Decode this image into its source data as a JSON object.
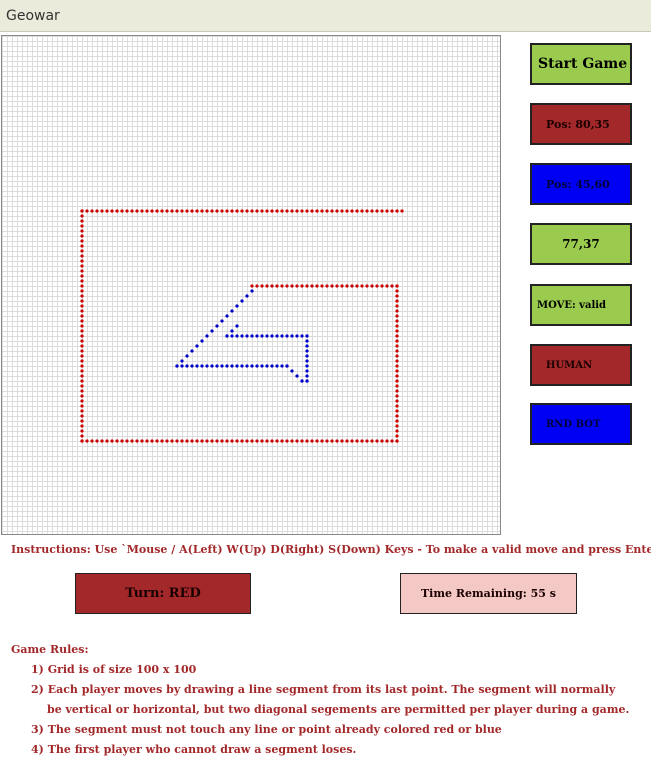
{
  "app": {
    "title": "Geowar"
  },
  "controls": {
    "start_label": "Start Game",
    "red_pos": "Pos: 80,35",
    "blue_pos": "Pos: 45,60",
    "cursor_coord": "77,37",
    "move_status": "MOVE: valid",
    "red_player": "HUMAN",
    "blue_player": "RND BOT"
  },
  "instructions": "Instructions: Use `Mouse / A(Left) W(Up) D(Right) S(Down) Keys - To make a valid move and press Enter`",
  "status": {
    "turn": "Turn: RED",
    "time": "Time Remaining: 55 s"
  },
  "rules": {
    "title": "Game Rules:",
    "items": [
      "1) Grid is of size 100 x 100",
      "2) Each player moves by drawing a line segment from its last point. The segment will normally",
      "be vertical or horizontal, but two diagonal segements are permitted per player during a game.",
      "3) The segment must not touch any line or point already colored red or blue",
      "4) The first player who cannot draw a segment loses."
    ]
  },
  "colors": {
    "red": "#cc0000",
    "blue": "#0000cc",
    "accent_green": "#9acb4e",
    "accent_red": "#a3282a",
    "accent_blue": "#0000f5"
  },
  "board": {
    "grid_size": 100,
    "red_path": [
      [
        80,
        35
      ],
      [
        16,
        35
      ],
      [
        16,
        81
      ],
      [
        79,
        81
      ],
      [
        79,
        50
      ],
      [
        50,
        50
      ]
    ],
    "blue_path": [
      [
        50,
        51
      ],
      [
        35,
        66
      ],
      [
        57,
        66
      ],
      [
        60,
        69
      ],
      [
        61,
        69
      ],
      [
        61,
        60
      ],
      [
        45,
        60
      ],
      [
        47,
        59
      ]
    ]
  }
}
